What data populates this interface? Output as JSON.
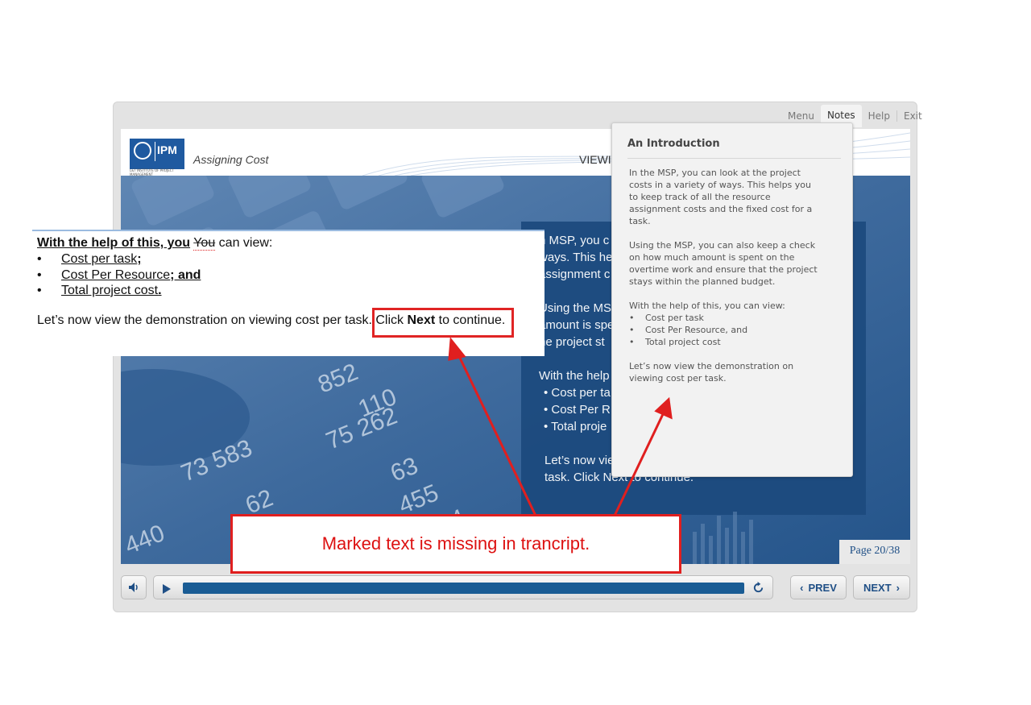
{
  "top_menu": {
    "menu": "Menu",
    "notes": "Notes",
    "help": "Help",
    "exit": "Exit"
  },
  "slide": {
    "logo_text": "IPM",
    "logo_subtext": "L&T INSTITUTE OF PROJECT MANAGEMENT",
    "title": "Assigning Cost",
    "heading_partial": "VIEWIN",
    "panel_lines": [
      "n MSP, you c",
      "ways. This he",
      "assignment c",
      "Using the MS",
      "amount is spe",
      "he project st",
      "With the help",
      "• Cost per ta",
      "• Cost Per R",
      "• Total proje",
      "Let’s now vie",
      "task. Click Next to continue."
    ],
    "page_label": "Page 20/38"
  },
  "notes_panel": {
    "title": "An Introduction",
    "para1": "In the MSP, you can look at the project costs in a variety of ways. This helps you to keep track of all the resource assignment costs and the fixed cost for a task.",
    "para2": "Using the MSP, you can also keep a check on how much amount is spent on the overtime work and ensure that the project stays within the planned budget.",
    "para3": "With the help of this, you can view:",
    "bullets": [
      "Cost per task",
      "Cost Per Resource, and",
      "Total project cost"
    ],
    "para4": "Let’s now view the demonstration on viewing cost per task."
  },
  "transcript": {
    "line1_bold": "With the help of this, you",
    "line1_strike": "You",
    "line1_rest": "can view:",
    "bullet": "•",
    "item1": "Cost per task",
    "item1_suffix": ";",
    "item2": "Cost Per Resource",
    "item2_suffix": "; and",
    "item3": "Total project cost",
    "item3_suffix": ".",
    "line_demo": "Let’s now view the demonstration on viewing cost per task.",
    "click": "Click",
    "next_word": "Next",
    "continue": "to continue."
  },
  "callout": {
    "text": "Marked text is missing in trancript."
  },
  "controls": {
    "prev": "PREV",
    "next": "NEXT",
    "progress": 1.0
  },
  "colors": {
    "accent": "#1f4f86",
    "annotation_red": "#e01f1f",
    "progress_fill": "#1a5c94"
  }
}
